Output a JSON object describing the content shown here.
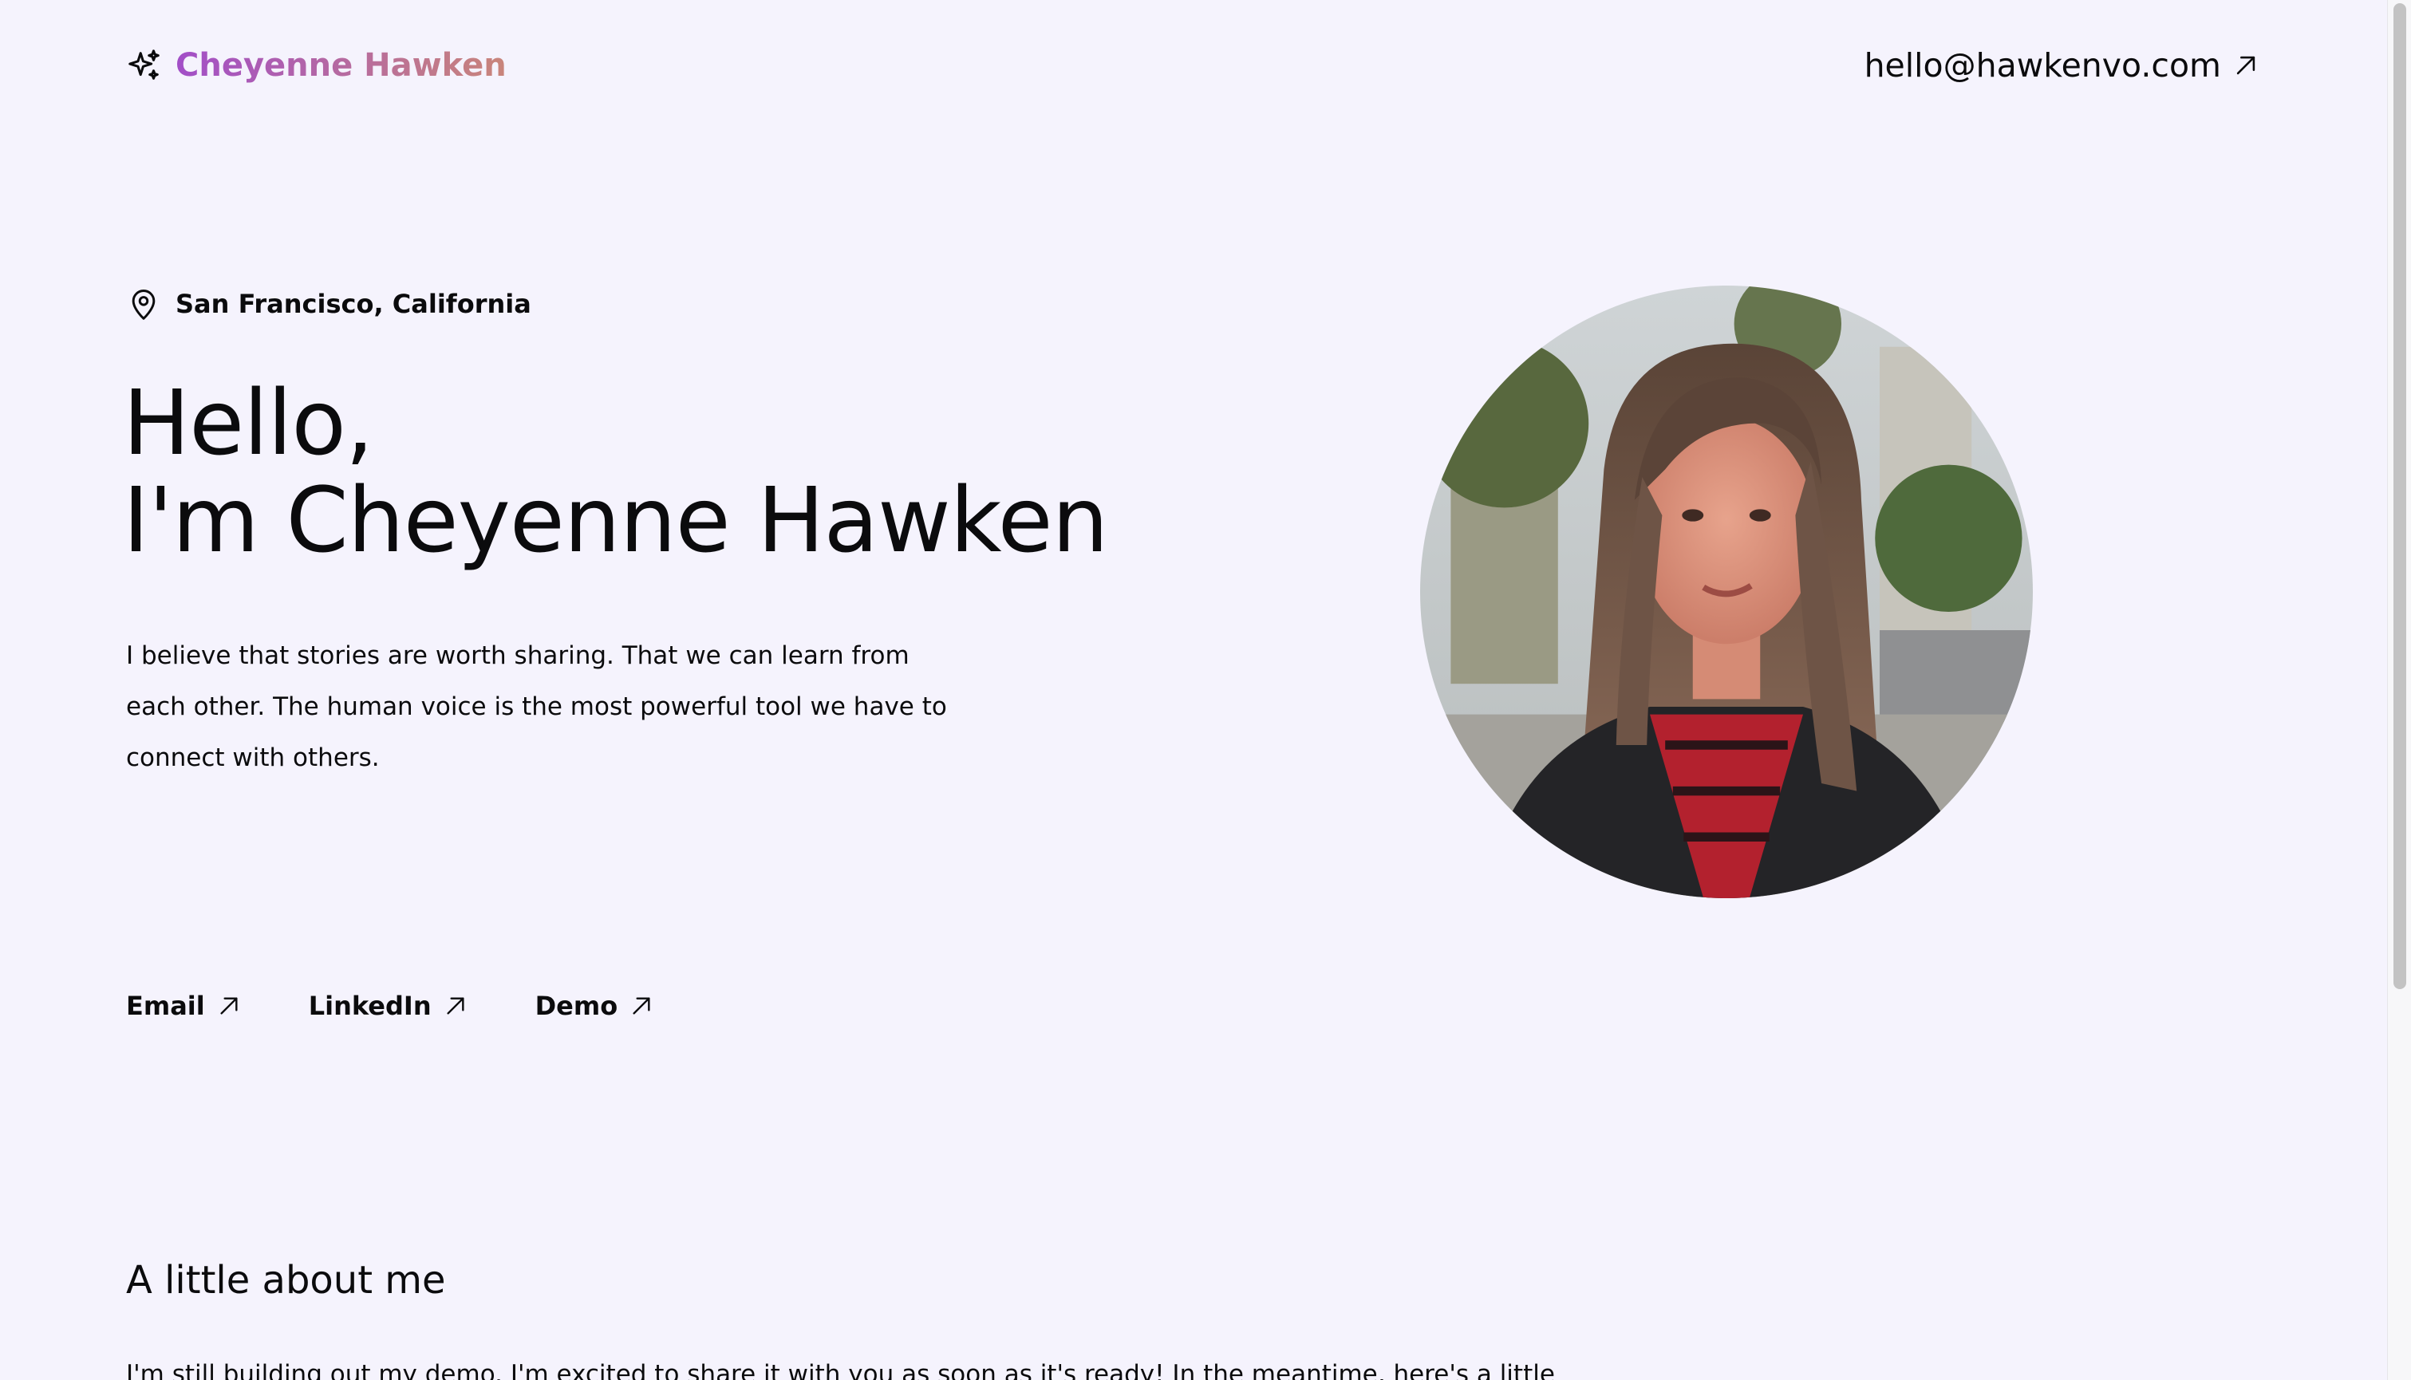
{
  "header": {
    "brand_icon": "sparkles-icon",
    "brand_name": "Cheyenne Hawken",
    "brand_gradient": [
      "#a24ec8",
      "#c9857a"
    ],
    "contact_email": "hello@hawkenvo.com",
    "contact_icon": "arrow-up-right-icon"
  },
  "hero": {
    "location_icon": "map-pin-icon",
    "location": "San Francisco, California",
    "heading_line1": "Hello,",
    "heading_line2": "I'm Cheyenne Hawken",
    "intro": "I believe that stories are worth sharing. That we can learn from each other. The human voice is the most powerful tool we have to connect with others.",
    "portrait_alt": "Portrait photo of Cheyenne Hawken"
  },
  "links": [
    {
      "label": "Email",
      "icon": "arrow-up-right-icon"
    },
    {
      "label": "LinkedIn",
      "icon": "arrow-up-right-icon"
    },
    {
      "label": "Demo",
      "icon": "arrow-up-right-icon"
    }
  ],
  "about": {
    "title": "A little about me",
    "text": "I'm still building out my demo. I'm excited to share it with you as soon as it's ready! In the meantime, here's a little about"
  },
  "colors": {
    "background": "#f5f3fd",
    "text": "#0b0b0d"
  }
}
